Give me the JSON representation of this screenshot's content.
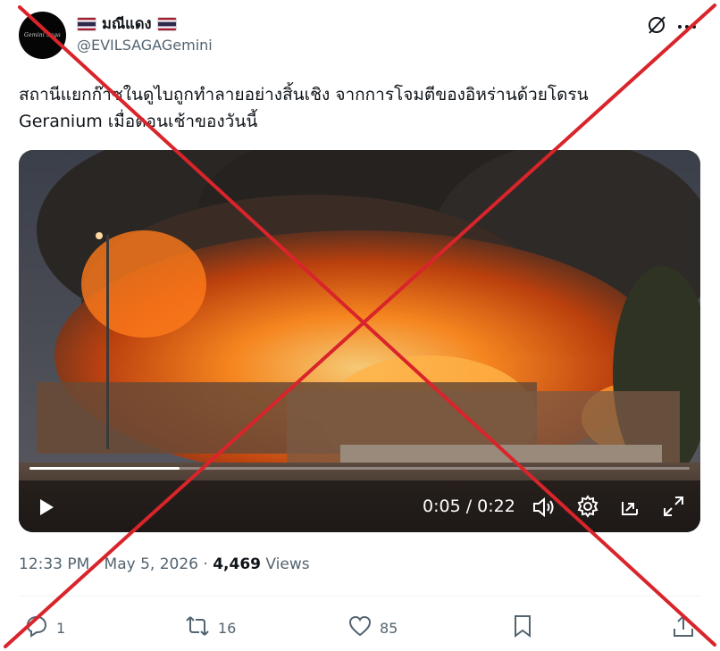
{
  "author": {
    "display_name": "มณีแดง",
    "handle": "@EVILSAGAGemini",
    "avatar_text": "Gemini Saga"
  },
  "tweet": {
    "text_line1": "สถานีแยกก๊าซในดูไบถูกทำลายอย่างสิ้นเชิง จากการโจมตีของอิหร่านด้วยโดรน",
    "text_line2": "Geranium เมื่อตอนเช้าของวันนี้"
  },
  "video": {
    "current_time": "0:05",
    "separator": "/",
    "duration": "0:22",
    "progress_fraction": 0.227
  },
  "meta": {
    "time": "12:33 PM",
    "dot1": "·",
    "date": "May 5, 2026",
    "dot2": "·",
    "views_count": "4,469",
    "views_label": "Views"
  },
  "actions": {
    "reply_count": "1",
    "retweet_count": "16",
    "like_count": "85"
  },
  "colors": {
    "text_primary": "#0f1419",
    "text_secondary": "#536471",
    "divider": "#eff3f4",
    "cross_mark": "#d9242b"
  },
  "icons": [
    "grok-icon",
    "more-icon",
    "play-icon",
    "volume-icon",
    "settings-icon",
    "pip-icon",
    "fullscreen-icon",
    "reply-icon",
    "retweet-icon",
    "like-icon",
    "bookmark-icon",
    "share-icon"
  ]
}
